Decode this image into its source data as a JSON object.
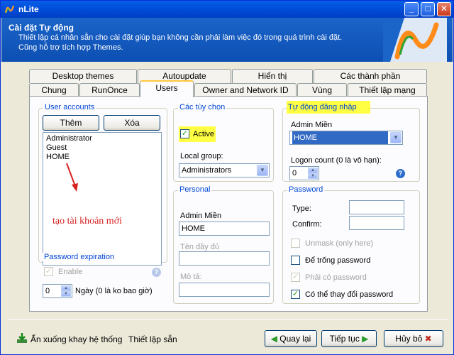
{
  "window": {
    "title": "nLite",
    "header_title": "Cài đặt Tự động",
    "header_line1": "Thiết lập cá nhân sẵn cho cài đặt giúp bạn không cần phải làm việc đó trong quá trình cài đặt.",
    "header_line2": "Cũng hỗ trợ tích hợp Themes."
  },
  "tabs_row1": [
    "Desktop themes",
    "Autoupdate",
    "Hiển thị",
    "Các thành phần"
  ],
  "tabs_row2": [
    "Chung",
    "RunOnce",
    "Users",
    "Owner and Network ID",
    "Vùng",
    "Thiết lập mạng"
  ],
  "active_tab": "Users",
  "user_accounts": {
    "label": "User accounts",
    "add_button": "Thêm",
    "delete_button": "Xóa",
    "users": [
      "Administrator",
      "Guest",
      "HOME"
    ],
    "annotation": "tạo tài khoản mới"
  },
  "password_expiration": {
    "label": "Password expiration",
    "enable_label": "Enable",
    "enable_checked": true,
    "days_value": "0",
    "days_label": "Ngày (0 là ko bao giờ)"
  },
  "options": {
    "label": "Các tùy chọn",
    "active_label": "Active",
    "active_checked": true,
    "local_group_label": "Local group:",
    "local_group_value": "Administrators"
  },
  "autologon": {
    "label": "Tự động đăng nhập",
    "admin_label": "Admin Miền",
    "admin_value": "HOME",
    "logon_count_label": "Logon count (0 là vô hạn):",
    "logon_count_value": "0"
  },
  "personal": {
    "label": "Personal",
    "admin_label": "Admin Miền",
    "admin_value": "HOME",
    "fullname_label": "Tên đầy đủ",
    "fullname_value": "",
    "description_label": "Mô tả:",
    "description_value": ""
  },
  "password": {
    "label": "Password",
    "type_label": "Type:",
    "confirm_label": "Confirm:",
    "unmask_label": "Unmask (only here)",
    "blank_label": "Để trống password",
    "required_label": "Phải có password",
    "can_change_label": "Có thể thay đổi password",
    "can_change_checked": true,
    "required_checked": true
  },
  "footer": {
    "tray_label": "Ẩn xuống khay hệ thống",
    "presets_label": "Thiết lập sẵn",
    "back_button": "Quay lại",
    "next_button": "Tiếp tục",
    "cancel_button": "Hủy bỏ"
  },
  "colors": {
    "title_bar": "#0050dc",
    "header_bg": "#1b64c8",
    "group_label": "#0046d5",
    "highlight": "#ffff44",
    "annotation": "#d82020"
  }
}
